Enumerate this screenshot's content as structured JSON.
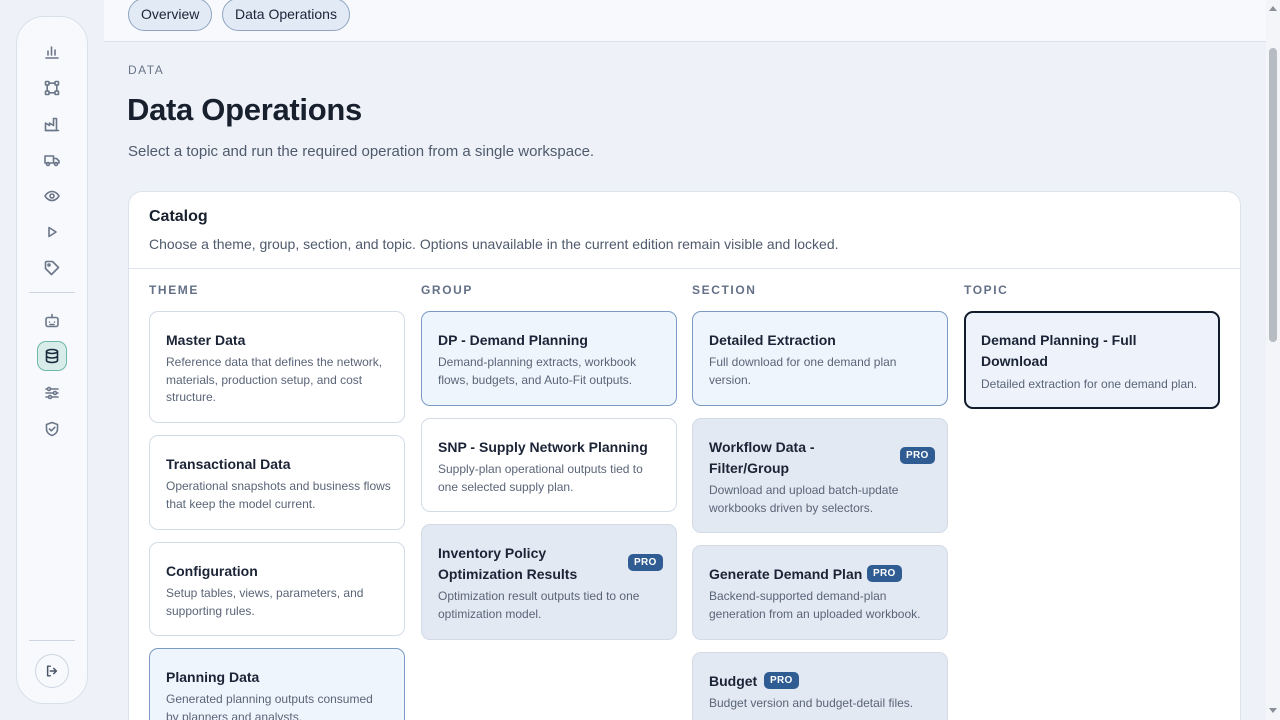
{
  "tabs": [
    {
      "label": "Overview"
    },
    {
      "label": "Data Operations"
    }
  ],
  "sidebar": {
    "icons": [
      "chart-bar-icon",
      "network-icon",
      "factory-icon",
      "truck-icon",
      "eye-icon",
      "play-icon",
      "tag-icon",
      "robot-icon",
      "database-icon",
      "sliders-icon",
      "shield-check-icon"
    ],
    "active": "database-icon",
    "logout_icon": "logout-icon"
  },
  "header": {
    "eyebrow": "DATA",
    "title": "Data Operations",
    "subtitle": "Select a topic and run the required operation from a single workspace."
  },
  "catalog": {
    "title": "Catalog",
    "description": "Choose a theme, group, section, and topic. Options unavailable in the current edition remain visible and locked.",
    "columns": {
      "theme": "THEME",
      "group": "GROUP",
      "section": "SECTION",
      "topic": "TOPIC"
    },
    "themes": [
      {
        "title": "Master Data",
        "desc": "Reference data that defines the network, materials, production setup, and cost structure."
      },
      {
        "title": "Transactional Data",
        "desc": "Operational snapshots and business flows that keep the model current."
      },
      {
        "title": "Configuration",
        "desc": "Setup tables, views, parameters, and supporting rules."
      },
      {
        "title": "Planning Data",
        "desc": "Generated planning outputs consumed by planners and analysts."
      }
    ],
    "groups": [
      {
        "title": "DP - Demand Planning",
        "desc": "Demand-planning extracts, workbook flows, budgets, and Auto-Fit outputs."
      },
      {
        "title": "SNP - Supply Network Planning",
        "desc": "Supply-plan operational outputs tied to one selected supply plan."
      },
      {
        "title": "Inventory Policy Optimization Results",
        "desc": "Optimization result outputs tied to one optimization model.",
        "badge": "PRO"
      }
    ],
    "sections": [
      {
        "title": "Detailed Extraction",
        "desc": "Full download for one demand plan version."
      },
      {
        "title": "Workflow Data - Filter/Group",
        "desc": "Download and upload batch-update workbooks driven by selectors.",
        "badge": "PRO"
      },
      {
        "title": "Generate Demand Plan",
        "desc": "Backend-supported demand-plan generation from an uploaded workbook.",
        "badge": "PRO"
      },
      {
        "title": "Budget",
        "desc": "Budget version and budget-detail files.",
        "badge": "PRO"
      }
    ],
    "topics": [
      {
        "title": "Demand Planning - Full Download",
        "desc": "Detailed extraction for one demand plan."
      }
    ]
  }
}
